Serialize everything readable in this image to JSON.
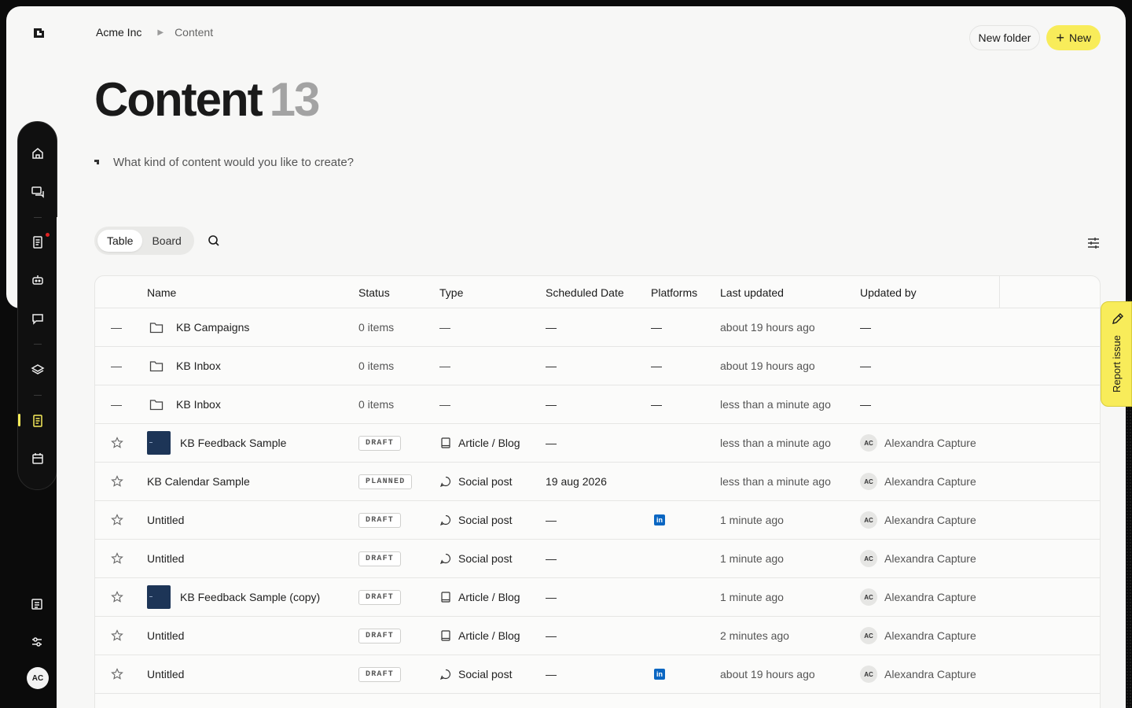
{
  "breadcrumb": {
    "org": "Acme Inc",
    "current": "Content"
  },
  "header": {
    "new_folder_label": "New folder",
    "new_label": "New"
  },
  "page": {
    "title": "Content",
    "count": "13"
  },
  "prompt": {
    "placeholder": "What kind of content would you like to create?"
  },
  "view": {
    "tabs": [
      "Table",
      "Board"
    ],
    "active": "Table"
  },
  "columns": [
    "Name",
    "Status",
    "Type",
    "Scheduled Date",
    "Platforms",
    "Last updated",
    "Updated by"
  ],
  "rows": [
    {
      "lead": "—",
      "kind": "folder",
      "name": "KB Campaigns",
      "status": "0 items",
      "type": "—",
      "scheduled": "—",
      "platform": "—",
      "updated": "about 19 hours ago",
      "by": "—"
    },
    {
      "lead": "—",
      "kind": "folder",
      "name": "KB Inbox",
      "status": "0 items",
      "type": "—",
      "scheduled": "—",
      "platform": "—",
      "updated": "about 19 hours ago",
      "by": "—"
    },
    {
      "lead": "—",
      "kind": "folder",
      "name": "KB Inbox",
      "status": "0 items",
      "type": "—",
      "scheduled": "—",
      "platform": "—",
      "updated": "less than a minute ago",
      "by": "—"
    },
    {
      "lead": "star",
      "kind": "thumb",
      "name": "KB Feedback Sample",
      "status": "DRAFT",
      "type": "Article / Blog",
      "type_icon": "book",
      "scheduled": "—",
      "platform": "",
      "updated": "less than a minute ago",
      "by": "Alexandra Capture",
      "by_initials": "AC"
    },
    {
      "lead": "star",
      "kind": "plain",
      "name": "KB Calendar Sample",
      "status": "PLANNED",
      "type": "Social post",
      "type_icon": "chat",
      "scheduled": "19 aug 2026",
      "platform": "",
      "updated": "less than a minute ago",
      "by": "Alexandra Capture",
      "by_initials": "AC"
    },
    {
      "lead": "star",
      "kind": "plain",
      "name": "Untitled",
      "status": "DRAFT",
      "type": "Social post",
      "type_icon": "chat",
      "scheduled": "—",
      "platform": "in",
      "updated": "1 minute ago",
      "by": "Alexandra Capture",
      "by_initials": "AC"
    },
    {
      "lead": "star",
      "kind": "plain",
      "name": "Untitled",
      "status": "DRAFT",
      "type": "Social post",
      "type_icon": "chat",
      "scheduled": "—",
      "platform": "",
      "updated": "1 minute ago",
      "by": "Alexandra Capture",
      "by_initials": "AC"
    },
    {
      "lead": "star",
      "kind": "thumb",
      "name": "KB Feedback Sample (copy)",
      "status": "DRAFT",
      "type": "Article / Blog",
      "type_icon": "book",
      "scheduled": "—",
      "platform": "",
      "updated": "1 minute ago",
      "by": "Alexandra Capture",
      "by_initials": "AC"
    },
    {
      "lead": "star",
      "kind": "plain",
      "name": "Untitled",
      "status": "DRAFT",
      "type": "Article / Blog",
      "type_icon": "book",
      "scheduled": "—",
      "platform": "",
      "updated": "2 minutes ago",
      "by": "Alexandra Capture",
      "by_initials": "AC"
    },
    {
      "lead": "star",
      "kind": "plain",
      "name": "Untitled",
      "status": "DRAFT",
      "type": "Social post",
      "type_icon": "chat",
      "scheduled": "—",
      "platform": "in",
      "updated": "about 19 hours ago",
      "by": "Alexandra Capture",
      "by_initials": "AC"
    }
  ],
  "user": {
    "initials": "AC"
  },
  "report": {
    "label": "Report issue"
  },
  "colors": {
    "accent": "#f8ec5a",
    "linkedin": "#0a66c2",
    "thumb": "#1d3557"
  }
}
